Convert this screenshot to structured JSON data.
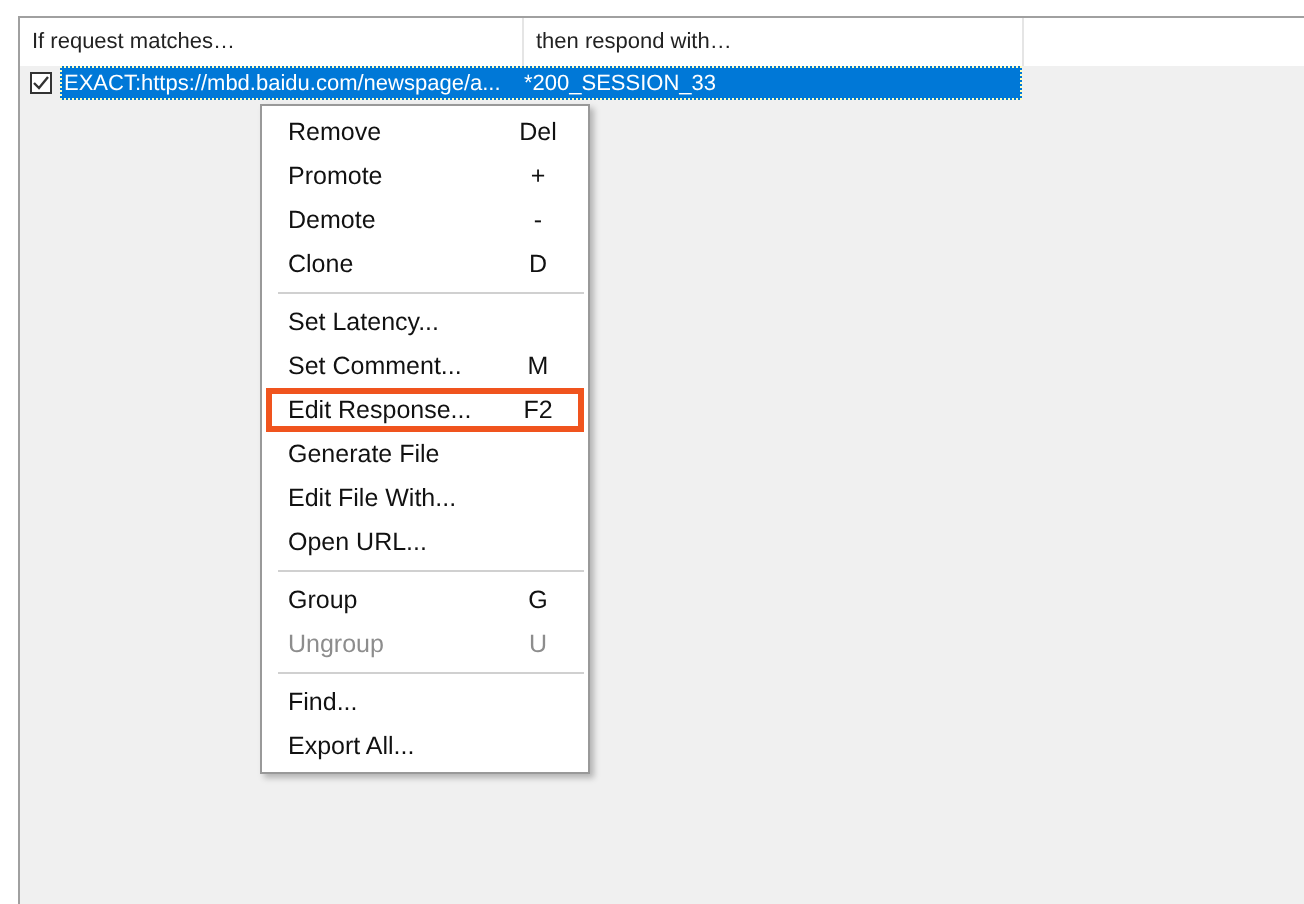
{
  "table": {
    "columns": [
      "If request matches…",
      "then respond with…"
    ],
    "rows": [
      {
        "checked": true,
        "selected": true,
        "match": "EXACT:https://mbd.baidu.com/newspage/a...",
        "response": "*200_SESSION_33"
      }
    ]
  },
  "context_menu": {
    "items": [
      {
        "kind": "item",
        "label": "Remove",
        "shortcut": "Del",
        "disabled": false,
        "highlighted": false
      },
      {
        "kind": "item",
        "label": "Promote",
        "shortcut": "+",
        "disabled": false,
        "highlighted": false
      },
      {
        "kind": "item",
        "label": "Demote",
        "shortcut": "-",
        "disabled": false,
        "highlighted": false
      },
      {
        "kind": "item",
        "label": "Clone",
        "shortcut": "D",
        "disabled": false,
        "highlighted": false
      },
      {
        "kind": "separator"
      },
      {
        "kind": "item",
        "label": "Set Latency...",
        "disabled": false,
        "highlighted": false
      },
      {
        "kind": "item",
        "label": "Set Comment...",
        "shortcut": "M",
        "disabled": false,
        "highlighted": false
      },
      {
        "kind": "item",
        "label": "Edit Response...",
        "shortcut": "F2",
        "disabled": false,
        "highlighted": true
      },
      {
        "kind": "item",
        "label": "Generate File",
        "disabled": false,
        "highlighted": false
      },
      {
        "kind": "item",
        "label": "Edit File With...",
        "disabled": false,
        "highlighted": false
      },
      {
        "kind": "item",
        "label": "Open URL...",
        "disabled": false,
        "highlighted": false
      },
      {
        "kind": "separator"
      },
      {
        "kind": "item",
        "label": "Group",
        "shortcut": "G",
        "disabled": false,
        "highlighted": false
      },
      {
        "kind": "item",
        "label": "Ungroup",
        "shortcut": "U",
        "disabled": true,
        "highlighted": false
      },
      {
        "kind": "separator"
      },
      {
        "kind": "item",
        "label": "Find...",
        "disabled": false,
        "highlighted": false
      },
      {
        "kind": "item",
        "label": "Export All...",
        "disabled": false,
        "highlighted": false
      }
    ]
  }
}
